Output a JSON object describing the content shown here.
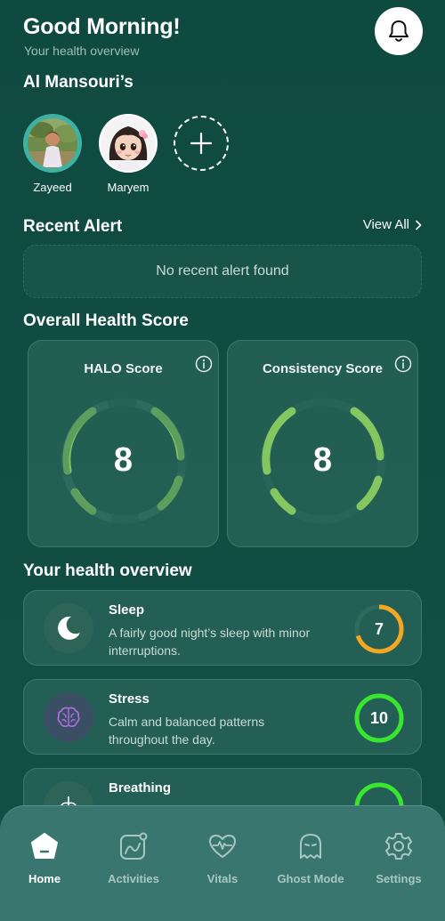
{
  "header": {
    "greeting": "Good Morning!",
    "subtitle": "Your health overview",
    "family_name": "Al Mansouri’s"
  },
  "members": [
    {
      "name": "Zayeed",
      "icon": "child-photo-avatar"
    },
    {
      "name": "Maryem",
      "icon": "girl-cartoon-avatar"
    }
  ],
  "recent_alert": {
    "title": "Recent Alert",
    "view_all": "View All",
    "empty_text": "No recent alert found"
  },
  "health_score": {
    "title": "Overall Health Score",
    "cards": [
      {
        "label": "HALO Score",
        "value": "8"
      },
      {
        "label": "Consistency Score",
        "value": "8"
      }
    ]
  },
  "overview": {
    "title": "Your health overview",
    "items": [
      {
        "title": "Sleep",
        "desc": "A fairly good night’s sleep with minor interruptions.",
        "score": "7",
        "score_fraction": 0.7,
        "color": "#f5a623",
        "icon": "moon-icon"
      },
      {
        "title": "Stress",
        "desc": "Calm and balanced patterns throughout the day.",
        "score": "10",
        "score_fraction": 1.0,
        "color": "#39e62f",
        "icon": "brain-icon"
      },
      {
        "title": "Breathing",
        "desc": "",
        "score": "",
        "score_fraction": 1.0,
        "color": "#39e62f",
        "icon": "lungs-icon"
      }
    ]
  },
  "nav": {
    "items": [
      {
        "label": "Home",
        "icon": "home-icon",
        "active": true
      },
      {
        "label": "Activities",
        "icon": "activities-icon"
      },
      {
        "label": "Vitals",
        "icon": "heart-pulse-icon"
      },
      {
        "label": "Ghost Mode",
        "icon": "ghost-icon"
      },
      {
        "label": "Settings",
        "icon": "gear-icon"
      }
    ]
  },
  "colors": {
    "accent_green": "#39e62f",
    "gauge_green": "#7fc45a",
    "sleep_orange": "#f5a623",
    "background": "#114c42"
  }
}
